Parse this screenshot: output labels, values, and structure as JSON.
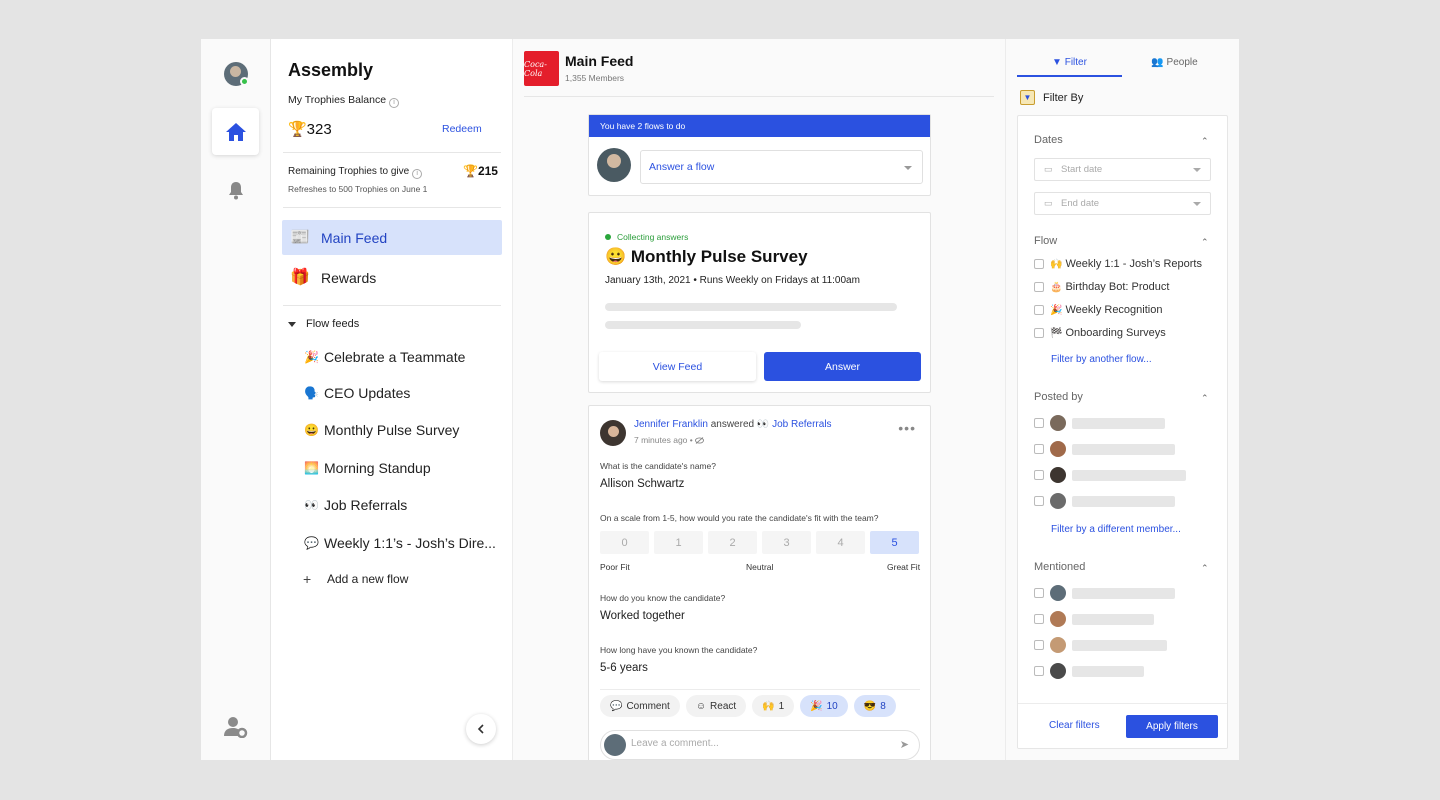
{
  "org_name": "Assembly",
  "trophies": {
    "balance_label": "My Trophies Balance",
    "balance_value": "🏆323",
    "redeem_label": "Redeem",
    "remaining_label": "Remaining Trophies to give",
    "remaining_value": "🏆215",
    "refresh_note": "Refreshes to 500 Trophies on June 1"
  },
  "nav": {
    "main_feed_label": "Main Feed",
    "main_feed_icon": "📰",
    "rewards_label": "Rewards",
    "rewards_icon": "🎁"
  },
  "flow_feeds": {
    "heading": "Flow feeds",
    "items": [
      {
        "emoji": "🎉",
        "label": "Celebrate a Teammate"
      },
      {
        "emoji": "🗣️",
        "label": "CEO Updates"
      },
      {
        "emoji": "😀",
        "label": "Monthly Pulse Survey"
      },
      {
        "emoji": "🌅",
        "label": "Morning Standup"
      },
      {
        "emoji": "👀",
        "label": "Job Referrals"
      },
      {
        "emoji": "💬",
        "label": "Weekly 1:1’s - Josh’s Dire..."
      }
    ],
    "add_label": "Add a new flow"
  },
  "header": {
    "logo_text": "Coca-Cola",
    "title": "Main Feed",
    "members": "1,355 Members"
  },
  "todo": {
    "banner": "You have 2 flows to do",
    "select_label": "Answer a flow"
  },
  "survey_card": {
    "status": "Collecting answers",
    "title": "😀 Monthly Pulse Survey",
    "meta": "January 13th, 2021 • Runs Weekly on Fridays at 11:00am",
    "view_feed_label": "View Feed",
    "answer_label": "Answer"
  },
  "post": {
    "author": "Jennifer Franklin",
    "action": "answered",
    "flow_emoji": "👀",
    "flow_name": "Job Referrals",
    "time": "7 minutes ago • ",
    "more": "•••",
    "q1": "What is the candidate's name?",
    "a1": "Allison Schwartz",
    "q2": "On a scale from 1-5, how would you rate the candidate's fit with the team?",
    "scale_options": [
      "0",
      "1",
      "2",
      "3",
      "4",
      "5"
    ],
    "scale_selected": "5",
    "scale_low": "Poor Fit",
    "scale_mid": "Neutral",
    "scale_high": "Great Fit",
    "q3": "How do you know the candidate?",
    "a3": "Worked together",
    "q4": "How long have you known the candidate?",
    "a4": "5-6 years",
    "comment_label": "Comment",
    "react_label": "React",
    "reactions": [
      {
        "emoji": "🙌",
        "count": "1",
        "active": false
      },
      {
        "emoji": "🎉",
        "count": "10",
        "active": true
      },
      {
        "emoji": "😎",
        "count": "8",
        "active": true
      }
    ],
    "comment_placeholder": "Leave a comment..."
  },
  "filter": {
    "tab_filter": "Filter",
    "tab_people": "People",
    "filter_by": "Filter By",
    "dates_heading": "Dates",
    "start_placeholder": "Start date",
    "end_placeholder": "End date",
    "flow_heading": "Flow",
    "flows": [
      {
        "emoji": "🙌",
        "label": "Weekly 1:1 - Josh’s Reports"
      },
      {
        "emoji": "🎂",
        "label": "Birthday Bot: Product"
      },
      {
        "emoji": "🎉",
        "label": "Weekly Recognition"
      },
      {
        "emoji": "🏁",
        "label": "Onboarding Surveys"
      }
    ],
    "flow_link": "Filter by another flow...",
    "posted_heading": "Posted by",
    "member_link": "Filter by a different member...",
    "mentioned_heading": "Mentioned",
    "clear_label": "Clear filters",
    "apply_label": "Apply filters"
  },
  "colors": {
    "accent": "#2b51e0",
    "active_bg": "#d7e2fb",
    "success": "#2aa63b"
  }
}
